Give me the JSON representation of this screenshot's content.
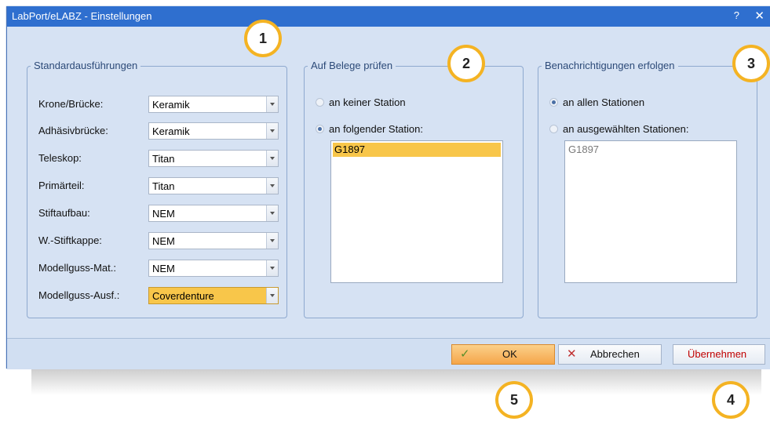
{
  "window": {
    "title": "LabPort/eLABZ - Einstellungen",
    "help": "?",
    "close": "✕"
  },
  "standard": {
    "legend": "Standardausführungen",
    "rows": [
      {
        "label": "Krone/Brücke:",
        "value": "Keramik"
      },
      {
        "label": "Adhäsivbrücke:",
        "value": "Keramik"
      },
      {
        "label": "Teleskop:",
        "value": "Titan"
      },
      {
        "label": "Primärteil:",
        "value": "Titan"
      },
      {
        "label": "Stiftaufbau:",
        "value": "NEM"
      },
      {
        "label": "W.-Stiftkappe:",
        "value": "NEM"
      },
      {
        "label": "Modellguss-Mat.:",
        "value": "NEM"
      },
      {
        "label": "Modellguss-Ausf.:",
        "value": "Coverdenture"
      }
    ]
  },
  "belege": {
    "legend": "Auf Belege prüfen",
    "option1": "an keiner Station",
    "option2": "an folgender Station:",
    "list": [
      "G1897"
    ]
  },
  "benachrichtigung": {
    "legend": "Benachrichtigungen erfolgen",
    "option1": "an allen Stationen",
    "option2": "an ausgewählten Stationen:",
    "list": [
      "G1897"
    ]
  },
  "buttons": {
    "ok": "OK",
    "cancel": "Abbrechen",
    "apply": "Übernehmen"
  },
  "callouts": [
    "1",
    "2",
    "3",
    "4",
    "5"
  ],
  "colors": {
    "titlebar": "#2f6fcf",
    "highlight": "#f8c64a",
    "callout_border": "#f4b323",
    "apply_text": "#c00000"
  }
}
